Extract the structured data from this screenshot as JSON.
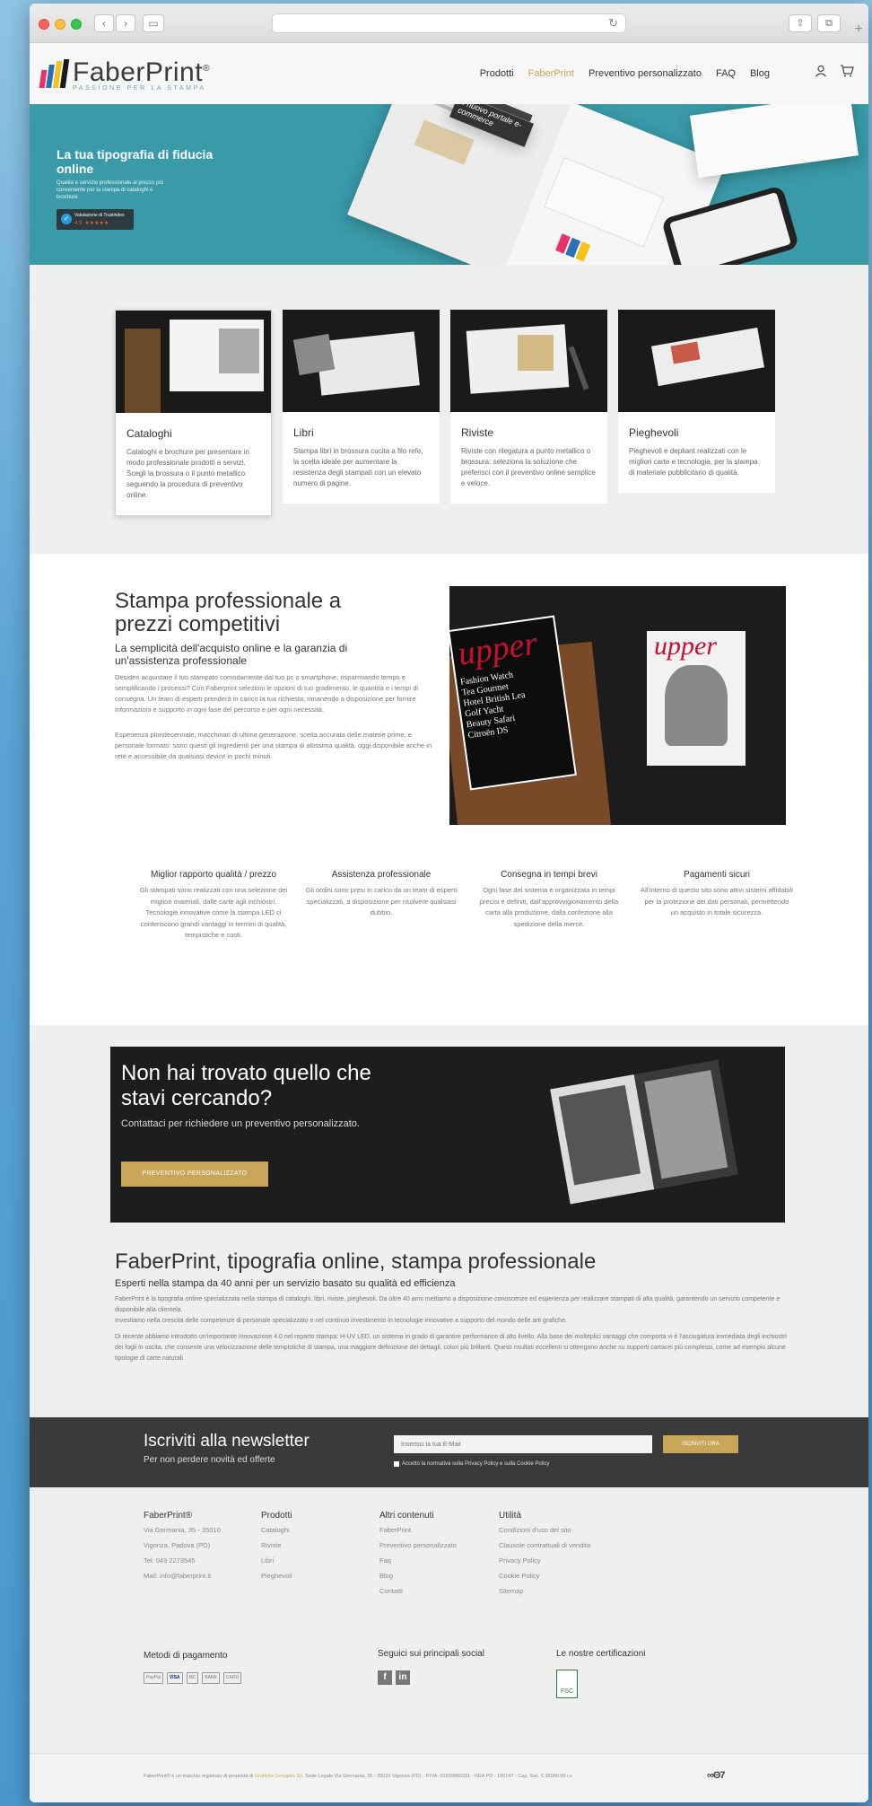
{
  "browser": {
    "url": "",
    "back_icon": "chevron-left-icon",
    "forward_icon": "chevron-right-icon"
  },
  "header": {
    "brand": "FaberPrint",
    "brand_mark": "®",
    "tagline": "PASSIONE PER LA STAMPA",
    "nav": [
      "Prodotti",
      "FaberPrint",
      "Preventivo personalizzato",
      "FAQ",
      "Blog"
    ],
    "active_nav": "FaberPrint",
    "logo_colors": [
      "#e8306b",
      "#2a6fb8",
      "#f4c21a",
      "#1a1a1a"
    ]
  },
  "hero": {
    "title": "La tua tipografia di fiducia online",
    "subtitle": "Qualità e servizio professionale al prezzo più conveniente per la stampa di cataloghi e brochure",
    "trust_label": "Valutazione di Trustindex",
    "trust_score": "4.9",
    "trust_stars": "★★★★★",
    "mockup_caption": "Il nuovo portale e-commerce"
  },
  "products": [
    {
      "title": "Cataloghi",
      "text": "Cataloghi e brochure per presentare in modo professionale prodotti e servizi. Scegli la brossura o il punto metallico seguendo la procedura di preventivo online."
    },
    {
      "title": "Libri",
      "text": "Stampa libri in brossura cucita a filo refe, la scelta ideale per aumentare la resistenza degli stampati con un elevato numero di pagine."
    },
    {
      "title": "Riviste",
      "text": "Riviste con rilegatura a punto metallico o brossura: seleziona la soluzione che preferisci con il preventivo online semplice e veloce."
    },
    {
      "title": "Pieghevoli",
      "text": "Pieghevoli e depliant realizzati con le migliori carte e tecnologie, per la stampa di materiale pubblicitario di qualità."
    }
  ],
  "stampa": {
    "title": "Stampa professionale a prezzi competitivi",
    "subtitle": "La semplicità dell'acquisto online e la garanzia di un'assistenza professionale",
    "para1": "Desideri acquistare il tuo stampato comodamente dal tuo pc o smartphone, risparmiando tempo e semplificando i processi? Con Faberprint selezioni le opzioni di tuo gradimento, le quantità e i tempi di consegna. Un team di esperti prenderà in carico la tua richiesta, rimanendo a disposizione per fornire informazioni e supporto in ogni fase del percorso e per ogni necessità.",
    "para2": "Esperienza pluridecennale, macchinari di ultima generazione, scelta accurata delle materie prime, e personale formato: sono questi gli ingredienti per una stampa di altissima qualità, oggi disponibile anche in rete e accessibile da qualsiasi device in pochi minuti.",
    "magazine_title": "upper",
    "magazine_words": [
      "Fashion",
      "Watch",
      "Tea",
      "Gourmet",
      "Hotel",
      "British Lea",
      "Golf",
      "Yacht",
      "Beauty",
      "Safari",
      "Citroën DS"
    ]
  },
  "features": [
    {
      "title": "Miglior rapporto qualità / prezzo",
      "text": "Gli stampati sono realizzati con una selezione dei migliori materiali, dalle carte agli inchiostri. Tecnologie innovative come la stampa LED ci conferiscono grandi vantaggi in termini di qualità, tempistiche e costi."
    },
    {
      "title": "Assistenza professionale",
      "text": "Gli ordini sono presi in carico da un team di esperti specializzati, a disposizione per risolvere qualsiasi dubbio."
    },
    {
      "title": "Consegna in tempi brevi",
      "text": "Ogni fase del sistema è organizzata in tempi precisi e definiti, dall'approvvigionamento della carta alla produzione, dalla confezione alla spedizione della merce."
    },
    {
      "title": "Pagamenti sicuri",
      "text": "All'interno di questo sito sono attivi sistemi affidabili per la protezione dei dati personali, permettendo un acquisto in totale sicurezza."
    }
  ],
  "cta": {
    "title": "Non hai trovato quello che stavi cercando?",
    "subtitle": "Contattaci per richiedere un preventivo personalizzato.",
    "button": "PREVENTIVO PERSONALIZZATO"
  },
  "about": {
    "title": "FaberPrint, tipografia online, stampa professionale",
    "subtitle": "Esperti nella stampa da 40 anni per un servizio basato su qualità ed efficienza",
    "para1": "FaberPrint è la tipografia online specializzata nella stampa di cataloghi, libri, riviste, pieghevoli. Da oltre 40 anni mettiamo a disposizione conoscenze ed esperienza per realizzare stampati di alta qualità, garantendo un servizio competente e disponibile alla clientela.",
    "para2": "Investiamo nella crescita delle competenze di personale specializzato e nel continuo investimento in tecnologie innovative a supporto del mondo delle arti grafiche.",
    "para3": "Di recente abbiamo introdotto un'importante innovazione 4.0 nel reparto stampa: H-UV LED, un sistema in grado di garantire performance di alto livello. Alla base dei molteplici vantaggi che comporta vi è l'asciugatura immediata degli inchiostri dei fogli in uscita, che consente una velocizzazione delle tempistiche di stampa, una maggiore definizione dei dettagli, colori più brillanti. Questi risultati eccellenti si ottengono anche su supporti cartacei più complessi, come ad esempio alcune tipologie di carte naturali."
  },
  "newsletter": {
    "title": "Iscriviti alla newsletter",
    "subtitle": "Per non perdere novità ed offerte",
    "placeholder": "Inserisci la tua E-Mail",
    "button": "ISCRIVITI ORA",
    "consent": "Accetto la normativa sulla Privacy Policy e sulla Cookie Policy"
  },
  "footer": {
    "columns": [
      {
        "title": "FaberPrint®",
        "items": [
          "Via Germania, 35 - 35010",
          "Vigonza, Padova (PD)",
          "Tel: 049 2273545",
          "Mail: info@faberprint.it"
        ]
      },
      {
        "title": "Prodotti",
        "items": [
          "Cataloghi",
          "Riviste",
          "Libri",
          "Pieghevoli"
        ]
      },
      {
        "title": "Altri contenuti",
        "items": [
          "FaberPrint",
          "Preventivo personalizzato",
          "Faq",
          "Blog",
          "Contatti"
        ]
      },
      {
        "title": "Utilità",
        "items": [
          "Condizioni d'uso del sito",
          "Clausole contrattuali di vendita",
          "Privacy Policy",
          "Cookie Policy",
          "Sitemap"
        ]
      }
    ],
    "payments_title": "Metodi di pagamento",
    "payments": [
      "PayPal",
      "VISA",
      "MC",
      "BANK",
      "CARD"
    ],
    "social_title": "Seguici sui principali social",
    "social": [
      "f",
      "in"
    ],
    "cert_title": "Le nostre certificazioni",
    "cert_label": "FSC",
    "copyright_pre": "FaberPrint® è un marchio registrato di proprietà di ",
    "copyright_link": "Grafiche Ceregato Srl",
    "copyright_post": ". Sede Legale Via Germania, 35 - 35010 Vigonza (PD) - P.IVA: 01509960281 - REA PD - 190147 - Cap. Soc. € 35000.00 i.v.",
    "bottom_logo": "∞Θ7"
  }
}
